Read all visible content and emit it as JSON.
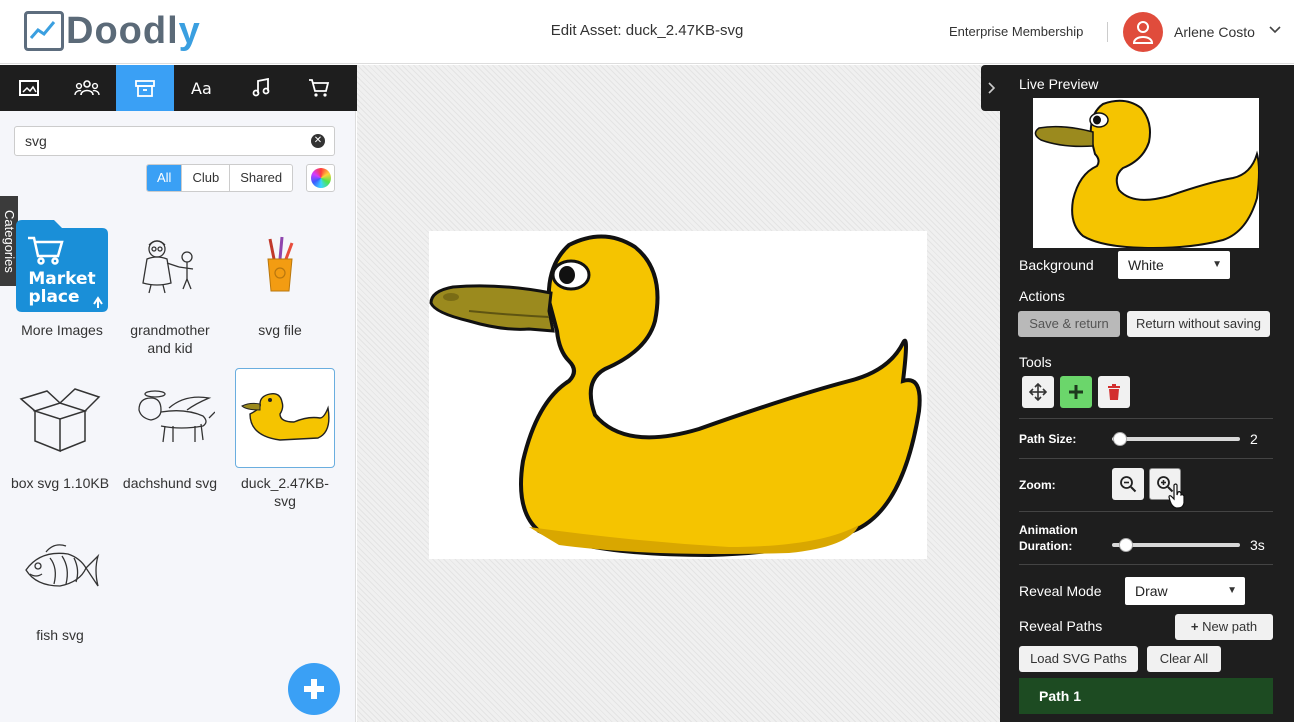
{
  "header": {
    "logo_text_main": "Doodl",
    "logo_text_accent": "y",
    "title": "Edit Asset: duck_2.47KB-svg",
    "membership": "Enterprise Membership",
    "user_name": "Arlene Costo"
  },
  "left_panel": {
    "tabs": [
      {
        "icon": "image-icon",
        "active": false
      },
      {
        "icon": "people-icon",
        "active": false
      },
      {
        "icon": "archive-box-icon",
        "active": true
      },
      {
        "icon": "text-font-icon",
        "active": false
      },
      {
        "icon": "music-note-icon",
        "active": false
      },
      {
        "icon": "cart-icon",
        "active": false
      }
    ],
    "search_value": "svg",
    "filters": [
      "All",
      "Club",
      "Shared"
    ],
    "active_filter": "All",
    "categories_label": "Categories",
    "assets": [
      {
        "label": "More Images",
        "thumb_text_1": "Market",
        "thumb_text_2": "place"
      },
      {
        "label": "grandmother and kid"
      },
      {
        "label": "svg file"
      },
      {
        "label": "box svg 1.10KB"
      },
      {
        "label": "dachshund svg"
      },
      {
        "label": "duck_2.47KB-svg",
        "selected": true
      },
      {
        "label": "fish svg"
      }
    ]
  },
  "right_panel": {
    "live_preview_label": "Live Preview",
    "background_label": "Background",
    "background_value": "White",
    "actions_label": "Actions",
    "save_return": "Save & return",
    "return_without_saving": "Return without saving",
    "tools_label": "Tools",
    "path_size_label": "Path Size:",
    "path_size_value": "2",
    "zoom_label": "Zoom:",
    "animation_label_1": "Animation",
    "animation_label_2": "Duration:",
    "animation_value": "3s",
    "reveal_mode_label": "Reveal Mode",
    "reveal_mode_value": "Draw",
    "reveal_paths_label": "Reveal Paths",
    "new_path": "New path",
    "load_svg_paths": "Load SVG Paths",
    "clear_all": "Clear All",
    "paths": [
      "Path 1"
    ]
  },
  "colors": {
    "accent": "#3aa0f5",
    "duck_body": "#f5c400",
    "duck_beak": "#9b8a1e",
    "avatar": "#e04c3c",
    "path_row": "#1d4b22"
  }
}
